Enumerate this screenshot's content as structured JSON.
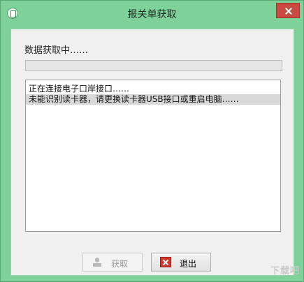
{
  "window": {
    "title": "报关单获取"
  },
  "status": {
    "text": "数据获取中……"
  },
  "progress": {
    "percent": 0
  },
  "log": {
    "lines": [
      "正在连接电子口岸接口……",
      "未能识别读卡器，请更换读卡器USB接口或重启电脑……"
    ]
  },
  "buttons": {
    "fetch_label": "获取",
    "exit_label": "退出"
  },
  "icons": {
    "app": "app-icon",
    "close": "close-icon",
    "fetch": "user-icon",
    "exit": "exit-icon"
  },
  "watermark": {
    "text": "下载吧"
  },
  "colors": {
    "frame": "#7fd19a",
    "close": "#c84a40",
    "exit_icon": "#d3382f"
  }
}
